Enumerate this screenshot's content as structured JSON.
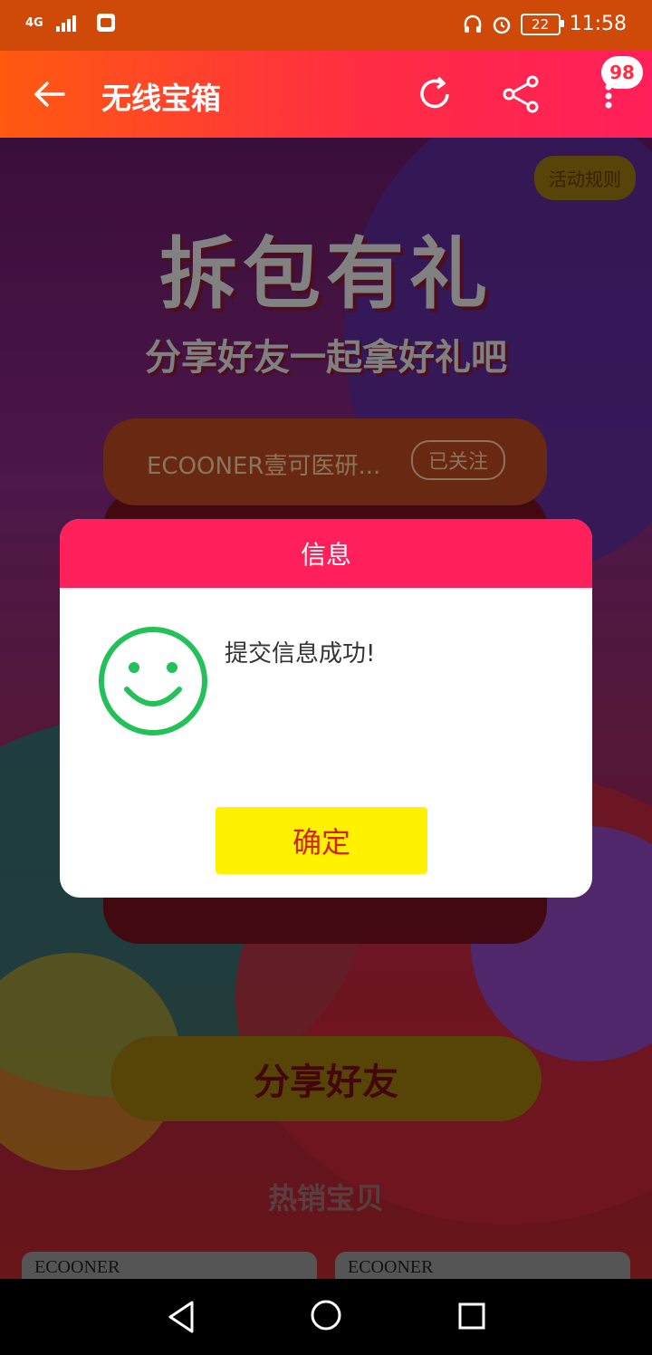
{
  "status_bar": {
    "network": "4G",
    "battery": "22",
    "time": "11:58"
  },
  "app_bar": {
    "title": "无线宝箱",
    "badge_count": "98"
  },
  "background": {
    "rules_label": "活动规则",
    "banner_title": "拆包有礼",
    "banner_subtitle": "分享好友一起拿好礼吧",
    "shop_name": "ECOONER壹可医研...",
    "follow_label": "已关注",
    "share_button": "分享好友",
    "hot_section": "热销宝贝",
    "products": [
      {
        "brand": "ECOONER"
      },
      {
        "brand": "ECOONER"
      }
    ]
  },
  "dialog": {
    "title": "信息",
    "message": "提交信息成功!",
    "confirm_label": "确定",
    "icon_color": "#24c05a"
  },
  "colors": {
    "accent": "#ff1f5a",
    "confirm_bg": "#fff200",
    "confirm_text": "#d2231f"
  }
}
